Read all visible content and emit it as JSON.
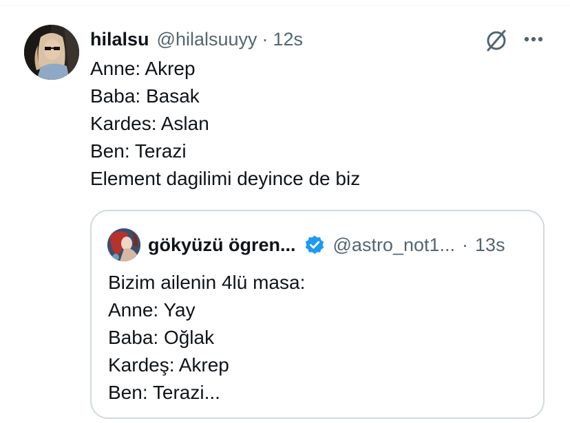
{
  "tweet": {
    "author_name": "hilalsu",
    "author_handle": "@hilalsuuyy",
    "separator": "·",
    "timestamp": "12s",
    "lines": [
      "Anne: Akrep",
      "Baba: Basak",
      "Kardes: Aslan",
      "Ben: Terazi",
      "Element dagilimi deyince de biz"
    ],
    "icons": {
      "grok": "grok-icon",
      "more": "more-icon"
    }
  },
  "quote": {
    "author_name": "gökyüzü ögren...",
    "verified": true,
    "author_handle": "@astro_not1...",
    "separator": "·",
    "timestamp": "13s",
    "lines": [
      "Bizim ailenin 4lü masa:",
      "Anne: Yay",
      "Baba: Oğlak",
      "Kardeş: Akrep",
      "Ben: Terazi..."
    ]
  },
  "colors": {
    "text": "#0f1419",
    "secondary": "#536471",
    "border": "#cfd9de",
    "verified": "#1d9bf0"
  }
}
